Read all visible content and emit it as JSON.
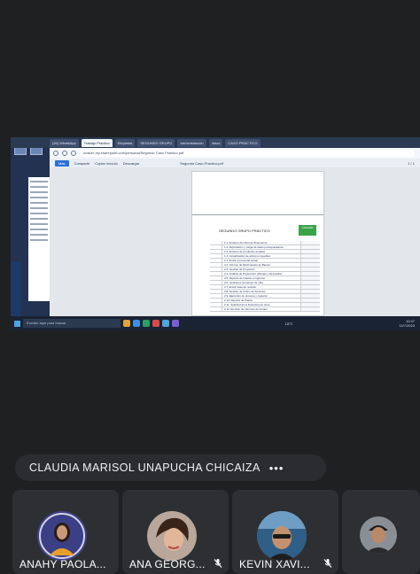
{
  "shared_screen": {
    "browser_tabs": [
      "(26) WhatsApp",
      "Trabajo Práctico",
      "Etiquetas",
      "SEGUNDO GRUPO",
      "Administración",
      "Inbox",
      "CASO PRÁCTICO"
    ],
    "url": "unacer-my.sharepoint.com/personal/Segundo Caso Practico.pdf",
    "toolbar": {
      "more_label": "Más",
      "share_label": "Compartir",
      "copy_link_label": "Copiar vínculo",
      "download_label": "Descargar",
      "file_name": "Segundo Caso Practico.pdf",
      "page_counter": "1 / 1"
    },
    "pdf": {
      "title": "SEGUNDO GRUPO PRÁCTICO",
      "logo_text": "UNACER",
      "rows": [
        "1.1. Emisión de informes financieros",
        "1.2. Exportación y carga de datos presupuestarios",
        "1.3. Emisión de productos anuales",
        "1.4. Actualización de activos inmuebles",
        "2.1. Emitir el personal actual",
        "2.2. Informe de Movimientos de Bienes",
        "2.3. Gestión de Proyectos",
        "2.4. Análisis de Producción (Ofertas y Demanda)",
        "2.5. Reporte de Gastos e Ingresos",
        "2.6. Gestiones de tiempo de vida",
        "2.7. Emitir base de revisión",
        "2.8. Gestión de Cobro de Servicios",
        "2.9. Ejecución de proceso y material",
        "2.10. Reporte de Planta",
        "2.11. Solicitud de la financiera de otros",
        "2.12. Emisión de informes de fondos"
      ]
    },
    "taskbar": {
      "search_placeholder": "Escribe aquí para buscar",
      "time": "10:47",
      "date": "12/7/2023",
      "weather": "18°C"
    }
  },
  "presenter": {
    "name": "CLAUDIA MARISOL UNAPUCHA CHICAIZA",
    "more_icon": "•••"
  },
  "participants": [
    {
      "name": "ANAHY PAOLA...",
      "mic_muted": false
    },
    {
      "name": "ANA GEORG...",
      "mic_muted": true
    },
    {
      "name": "KEVIN XAVI...",
      "mic_muted": true
    },
    {
      "name": "",
      "mic_muted": false
    }
  ],
  "colors": {
    "background": "#1f2022",
    "tile": "#2e2f33",
    "pill": "#2b2c30",
    "accent_green": "#3aa34a"
  }
}
